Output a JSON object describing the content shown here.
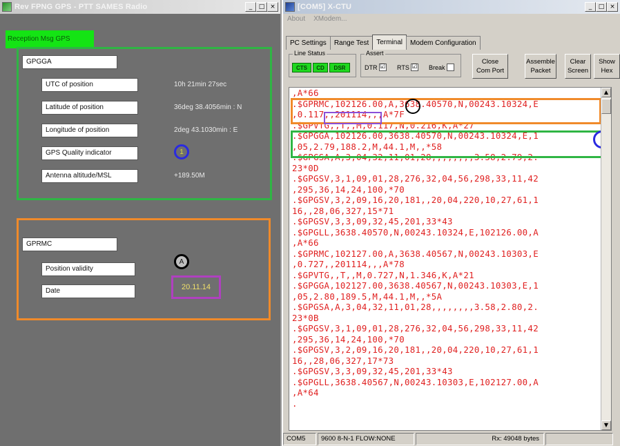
{
  "left_window": {
    "title": "Rev FPNG GPS - PTT SAMES Radio",
    "caption_buttons": [
      "_",
      "□",
      "×"
    ],
    "reception_label": "Reception Msg GPS",
    "gpgga": {
      "header": "GPGGA",
      "rows": [
        {
          "label": "UTC of position",
          "value": "10h 21min 27sec"
        },
        {
          "label": "Latitude of position",
          "value": "36deg 38.4056min : N"
        },
        {
          "label": "Longitude of position",
          "value": "2deg 43.1030min : E"
        },
        {
          "label": "GPS Quality indicator",
          "value": "1"
        },
        {
          "label": "Antenna altitude/MSL",
          "value": "+189.50M"
        }
      ]
    },
    "gprmc": {
      "header": "GPRMC",
      "rows": [
        {
          "label": "Position validity",
          "value": "A"
        },
        {
          "label": "Date",
          "value": "20.11.14"
        }
      ]
    },
    "colors": {
      "green_box": "#2fb544",
      "orange_box": "#f08a2a",
      "blue_circle": "#2a2ae0",
      "purple_box": "#b040c0"
    }
  },
  "right_window": {
    "title": "[COM5] X-CTU",
    "caption_buttons": [
      "_",
      "□",
      "×"
    ],
    "menu": [
      "About",
      "XModem..."
    ],
    "tabs": [
      "PC Settings",
      "Range Test",
      "Terminal",
      "Modem Configuration"
    ],
    "active_tab": "Terminal",
    "line_status": {
      "label": "Line Status",
      "leds": [
        "CTS",
        "CD",
        "DSR"
      ]
    },
    "assert": {
      "label": "Assert",
      "checks": [
        {
          "label": "DTR",
          "mark": "☑"
        },
        {
          "label": "RTS",
          "mark": "☑"
        },
        {
          "label": "Break",
          "mark": ""
        }
      ]
    },
    "buttons": [
      "Close\nCom Port",
      "Assemble\nPacket",
      "Clear\nScreen",
      "Show\nHex"
    ],
    "terminal_lines": [
      ",A*66",
      ".$GPRMC,102126.00,A,3638.40570,N,00243.10324,E",
      ",0.117,,201114,,,A*7F",
      ".$GPVTG,,T,,M,0.117,N,0.216,K,A*27",
      ".$GPGGA,102126.00,3638.40570,N,00243.10324,E,1",
      ",05,2.79,188.2,M,44.1,M,,*58",
      ".$GPGSA,A,3,04,32,11,01,28,,,,,,,,3.58,2.79,2.",
      "23*0D",
      ".$GPGSV,3,1,09,01,28,276,32,04,56,298,33,11,42",
      ",295,36,14,24,100,*70",
      ".$GPGSV,3,2,09,16,20,181,,20,04,220,10,27,61,1",
      "16,,28,06,327,15*71",
      ".$GPGSV,3,3,09,32,45,201,33*43",
      ".$GPGLL,3638.40570,N,00243.10324,E,102126.00,A",
      ",A*66",
      ".$GPRMC,102127.00,A,3638.40567,N,00243.10303,E",
      ",0.727,,201114,,,A*78",
      ".$GPVTG,,T,,M,0.727,N,1.346,K,A*21",
      ".$GPGGA,102127.00,3638.40567,N,00243.10303,E,1",
      ",05,2.80,189.5,M,44.1,M,,*5A",
      ".$GPGSA,A,3,04,32,11,01,28,,,,,,,,3.58,2.80,2.",
      "23*0B",
      ".$GPGSV,3,1,09,01,28,276,32,04,56,298,33,11,42",
      ",295,36,14,24,100,*70",
      ".$GPGSV,3,2,09,16,20,181,,20,04,220,10,27,61,1",
      "16,,28,06,327,17*73",
      ".$GPGSV,3,3,09,32,45,201,33*43",
      ".$GPGLL,3638.40567,N,00243.10303,E,102127.00,A",
      ",A*64",
      "."
    ],
    "scroll_arrows": {
      "up": "▲",
      "down": "▼"
    },
    "status_bar": [
      "COM5",
      "9600 8-N-1  FLOW:NONE",
      "Rx: 49048 bytes",
      ""
    ],
    "colors": {
      "terminal_text": "#e02020",
      "led_on": "#1ed81e"
    }
  }
}
